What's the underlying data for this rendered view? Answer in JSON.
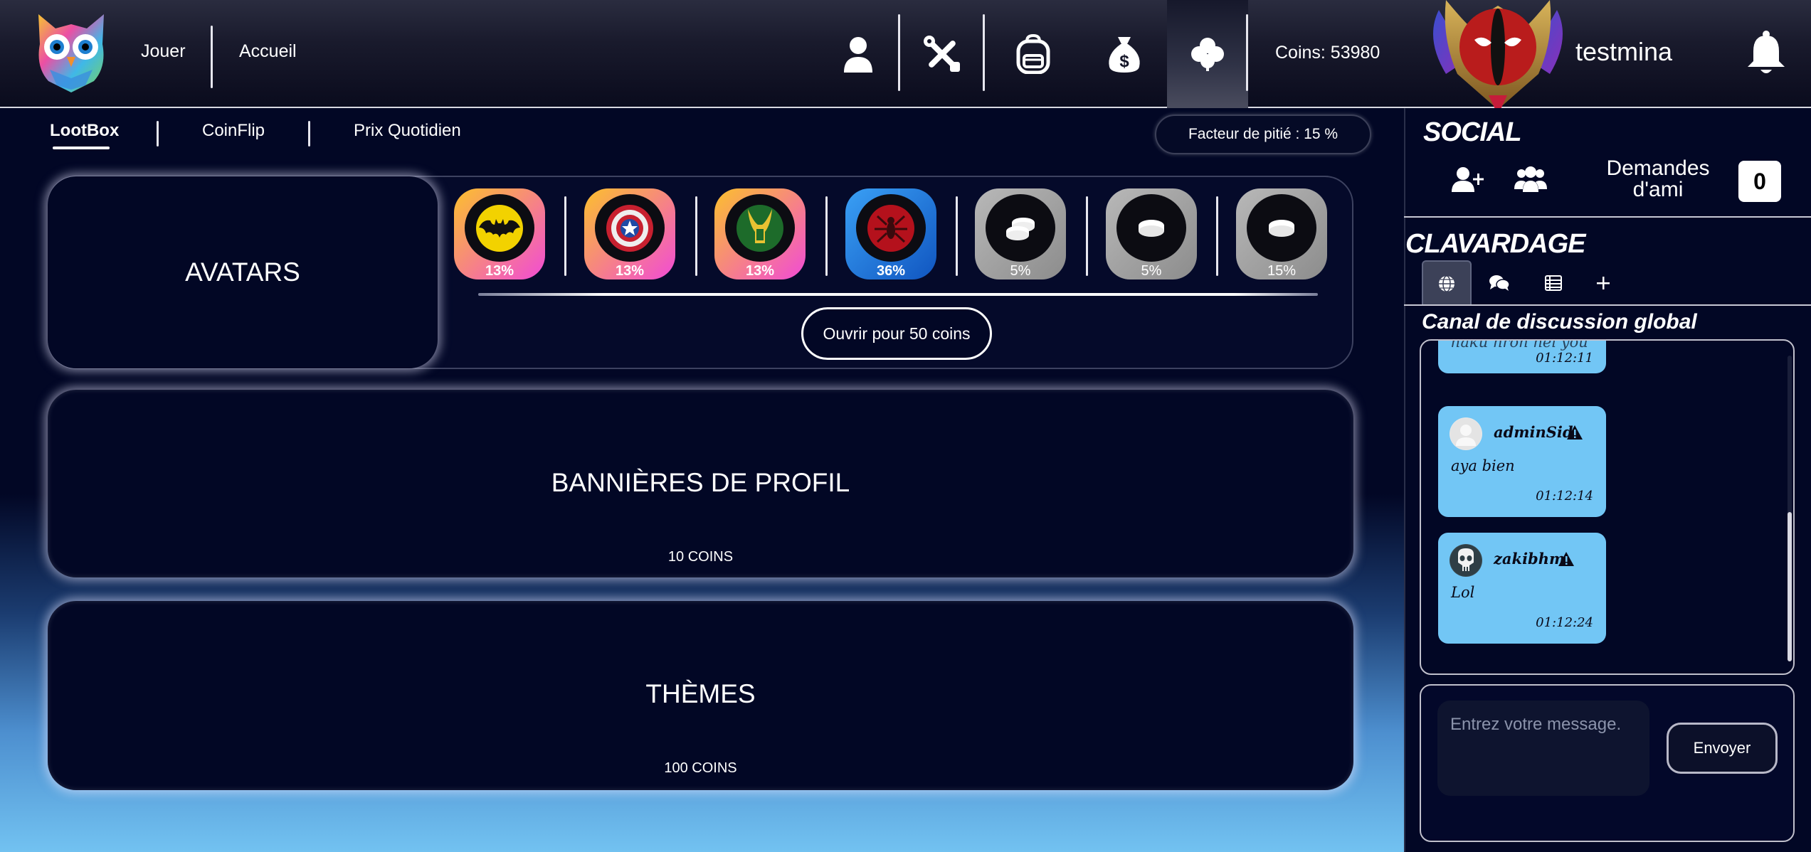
{
  "nav": {
    "play": "Jouer",
    "home": "Accueil",
    "icons": [
      "user-icon",
      "tools-icon",
      "backpack-icon",
      "money-bag-icon",
      "clover-icon"
    ],
    "coins": "Coins: 53980",
    "username": "testmina"
  },
  "subtabs": {
    "lootbox": "LootBox",
    "coinflip": "CoinFlip",
    "daily": "Prix Quotidien",
    "pity": "Facteur de pitié : 15 %"
  },
  "avatars_card": {
    "title": "AVATARS",
    "rewards": [
      {
        "name": "batman-avatar",
        "pct": "13%"
      },
      {
        "name": "captain-america-avatar",
        "pct": "13%"
      },
      {
        "name": "loki-avatar",
        "pct": "13%"
      },
      {
        "name": "spiderman-avatar",
        "pct": "36%"
      },
      {
        "name": "coins-stack-icon",
        "pct": "5%"
      },
      {
        "name": "coin-icon",
        "pct": "5%"
      },
      {
        "name": "coin-icon",
        "pct": "15%"
      }
    ],
    "open_button": "Ouvrir pour 50 coins"
  },
  "banners_card": {
    "title": "BANNIÈRES DE PROFIL",
    "price": "10 COINS"
  },
  "themes_card": {
    "title": "THÈMES",
    "price": "100 COINS"
  },
  "social": {
    "title": "SOCIAL",
    "friend_requests_label": "Demandes d'ami",
    "friend_requests_count": "0"
  },
  "chat": {
    "title": "CLAVARDAGE",
    "channel_title": "Canal de discussion global",
    "messages": [
      {
        "user": "",
        "text": "haku nron nei you",
        "time": "01:12:11"
      },
      {
        "user": "adminSid",
        "text": "aya bien",
        "time": "01:12:14"
      },
      {
        "user": "zakibhm",
        "text": "Lol",
        "time": "01:12:24"
      }
    ],
    "input_placeholder": "Entrez votre message.",
    "send_button": "Envoyer"
  },
  "colors": {
    "background": "#020725",
    "bubble": "#72c6f5",
    "accent_gold": "#f9b52e",
    "accent_pink": "#f24bd8"
  }
}
